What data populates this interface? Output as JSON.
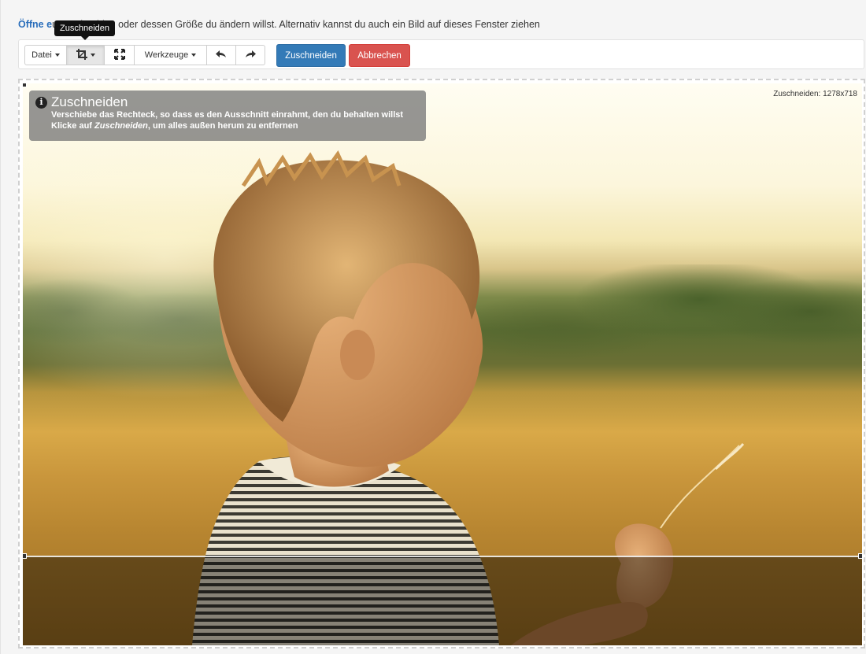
{
  "intro": {
    "lead": "Öffne e",
    "rest": "u zuschneiden oder dessen Größe du ändern willst. Alternativ kannst du auch ein Bild auf dieses Fenster ziehen"
  },
  "tooltip": {
    "text": "Zuschneiden"
  },
  "toolbar": {
    "file_label": "Datei",
    "crop_icon": "crop-icon",
    "resize_icon": "resize-arrows-icon",
    "tools_label": "Werkzeuge",
    "undo_icon": "undo-arrow-icon",
    "redo_icon": "redo-arrow-icon",
    "apply_label": "Zuschneiden",
    "cancel_label": "Abbrechen"
  },
  "info": {
    "title": "Zuschneiden",
    "line1": "Verschiebe das Rechteck, so dass es den Ausschnitt einrahmt, den du behalten willst",
    "line2_prefix": "Klicke auf ",
    "line2_em": "Zuschneiden",
    "line2_suffix": ", um alles außen herum zu entfernen"
  },
  "crop": {
    "size_label": "Zuschneiden: 1278x718"
  },
  "colors": {
    "primary": "#337ab7",
    "danger": "#d9534f",
    "lead_link": "#2a6ebb"
  }
}
